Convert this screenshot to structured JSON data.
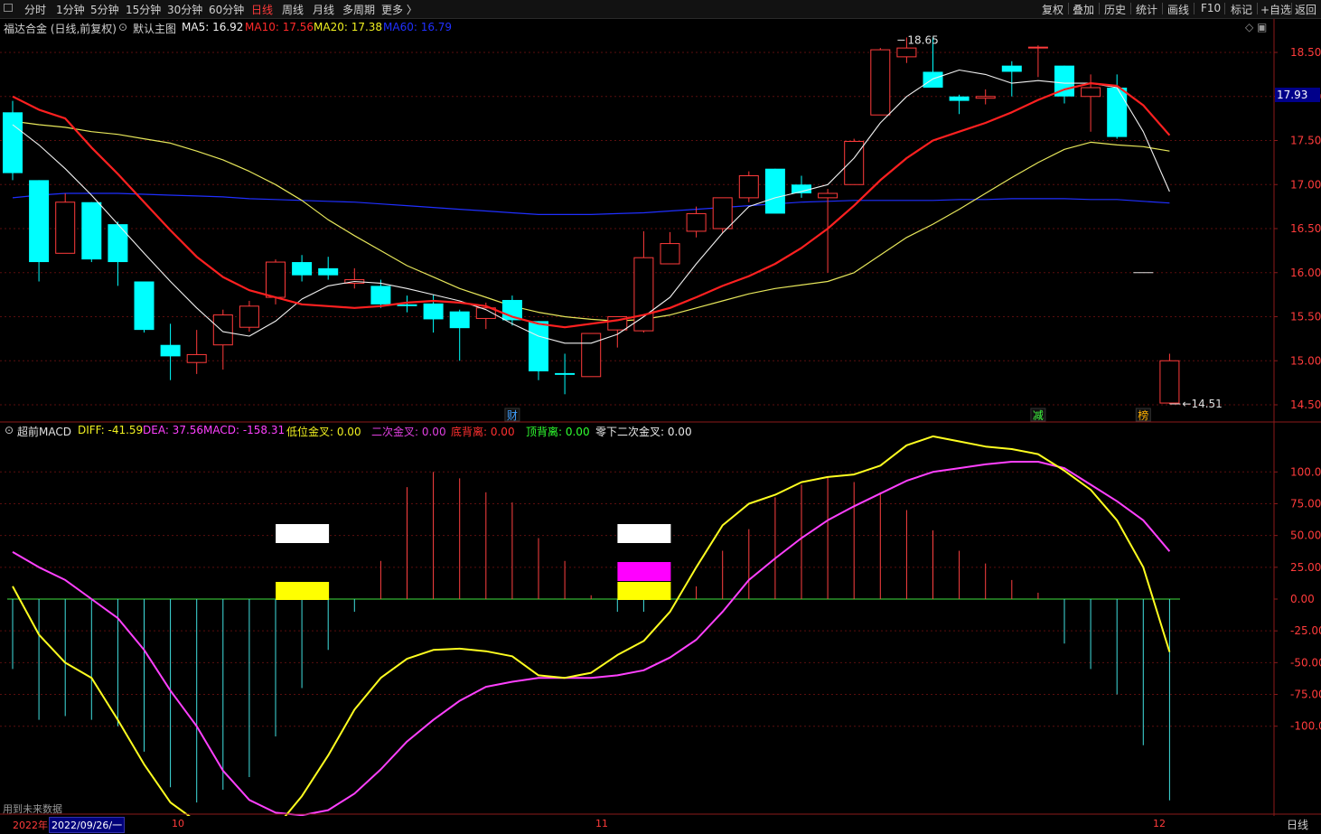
{
  "toolbar": {
    "periods": [
      "分时",
      "1分钟",
      "5分钟",
      "15分钟",
      "30分钟",
      "60分钟",
      "日线",
      "周线",
      "月线",
      "多周期",
      "更多 〉"
    ],
    "active_period": "日线",
    "right_buttons": [
      "复权",
      "叠加",
      "历史",
      "统计",
      "画线",
      "F10",
      "标记",
      "+自选",
      "返回"
    ]
  },
  "main_chart": {
    "stock_label": "福达合金 (日线,前复权)",
    "template_label": "默认主图",
    "ma": [
      {
        "name": "MA5",
        "value": "16.92",
        "color": "#f0f0f0"
      },
      {
        "name": "MA10",
        "value": "17.56",
        "color": "#ff2a2a"
      },
      {
        "name": "MA20",
        "value": "17.38",
        "color": "#f0f020"
      },
      {
        "name": "MA60",
        "value": "16.79",
        "color": "#2030ff"
      }
    ],
    "price_ticks": [
      "18.50",
      "18.00",
      "17.50",
      "17.00",
      "16.50",
      "16.00",
      "15.50",
      "15.00",
      "14.50"
    ],
    "high_label": "18.65",
    "low_label": "14.51",
    "current_price": "17.93",
    "markers": [
      {
        "text": "财",
        "color": "#40a0ff"
      },
      {
        "text": "减",
        "color": "#40ff40"
      },
      {
        "text": "榜",
        "color": "#ffb000"
      }
    ]
  },
  "macd_panel": {
    "title": "超前MACD",
    "items": [
      {
        "label": "DIFF: -41.59",
        "color": "#f0f020"
      },
      {
        "label": "DEA: 37.56",
        "color": "#ff40ff"
      },
      {
        "label": "MACD: -158.31",
        "color": "#ff40ff"
      },
      {
        "label": "低位金叉: 0.00",
        "color": "#f0f020"
      },
      {
        "label": "二次金叉: 0.00",
        "color": "#e040e0"
      },
      {
        "label": "底背离: 0.00",
        "color": "#ff3030"
      },
      {
        "label": "顶背离: 0.00",
        "color": "#30ff30"
      },
      {
        "label": "零下二次金叉: 0.00",
        "color": "#e8e8e8"
      }
    ],
    "ticks": [
      "100.0",
      "75.00",
      "50.00",
      "25.00",
      "0.00",
      "-25.00",
      "-50.00",
      "-75.00",
      "-100.0"
    ]
  },
  "footer": {
    "note": "用到未来数据",
    "year": "2022年",
    "cursor_date": "2022/09/26/一",
    "months": [
      "10",
      "11",
      "12"
    ],
    "period": "日线"
  },
  "chart_data": {
    "type": "candlestick",
    "title": "福达合金 (日线,前复权)",
    "ylim": [
      14.35,
      18.9
    ],
    "candles": [
      {
        "o": 17.82,
        "h": 17.95,
        "l": 17.05,
        "c": 17.13
      },
      {
        "o": 17.05,
        "h": 17.05,
        "l": 15.9,
        "c": 16.12
      },
      {
        "o": 16.22,
        "h": 16.9,
        "l": 16.22,
        "c": 16.8
      },
      {
        "o": 16.8,
        "h": 16.8,
        "l": 16.12,
        "c": 16.15
      },
      {
        "o": 16.55,
        "h": 16.58,
        "l": 15.85,
        "c": 16.12
      },
      {
        "o": 15.9,
        "h": 15.9,
        "l": 15.32,
        "c": 15.35
      },
      {
        "o": 15.18,
        "h": 15.42,
        "l": 14.78,
        "c": 15.05
      },
      {
        "o": 14.98,
        "h": 15.35,
        "l": 14.85,
        "c": 15.07
      },
      {
        "o": 15.18,
        "h": 15.58,
        "l": 14.9,
        "c": 15.52
      },
      {
        "o": 15.38,
        "h": 15.68,
        "l": 15.33,
        "c": 15.62
      },
      {
        "o": 15.72,
        "h": 16.15,
        "l": 15.64,
        "c": 16.12
      },
      {
        "o": 16.12,
        "h": 16.2,
        "l": 15.9,
        "c": 15.97
      },
      {
        "o": 16.05,
        "h": 16.18,
        "l": 15.92,
        "c": 15.97
      },
      {
        "o": 15.88,
        "h": 16.05,
        "l": 15.82,
        "c": 15.92
      },
      {
        "o": 15.85,
        "h": 15.92,
        "l": 15.6,
        "c": 15.64
      },
      {
        "o": 15.64,
        "h": 15.74,
        "l": 15.55,
        "c": 15.62
      },
      {
        "o": 15.65,
        "h": 15.75,
        "l": 15.32,
        "c": 15.47
      },
      {
        "o": 15.56,
        "h": 15.58,
        "l": 15.0,
        "c": 15.37
      },
      {
        "o": 15.48,
        "h": 15.66,
        "l": 15.36,
        "c": 15.6
      },
      {
        "o": 15.69,
        "h": 15.74,
        "l": 15.4,
        "c": 15.46
      },
      {
        "o": 15.45,
        "h": 15.45,
        "l": 14.78,
        "c": 14.88
      },
      {
        "o": 14.86,
        "h": 15.08,
        "l": 14.62,
        "c": 14.84
      },
      {
        "o": 14.82,
        "h": 15.3,
        "l": 14.82,
        "c": 15.31
      },
      {
        "o": 15.35,
        "h": 15.48,
        "l": 15.15,
        "c": 15.5
      },
      {
        "o": 15.34,
        "h": 16.47,
        "l": 15.32,
        "c": 16.17
      },
      {
        "o": 16.1,
        "h": 16.46,
        "l": 16.1,
        "c": 16.33
      },
      {
        "o": 16.47,
        "h": 16.75,
        "l": 16.4,
        "c": 16.67
      },
      {
        "o": 16.5,
        "h": 16.85,
        "l": 16.45,
        "c": 16.85
      },
      {
        "o": 16.85,
        "h": 17.15,
        "l": 16.8,
        "c": 17.1
      },
      {
        "o": 17.18,
        "h": 17.18,
        "l": 16.7,
        "c": 16.67
      },
      {
        "o": 17.0,
        "h": 17.1,
        "l": 16.85,
        "c": 16.9
      },
      {
        "o": 16.85,
        "h": 16.95,
        "l": 16.0,
        "c": 16.9
      },
      {
        "o": 17.0,
        "h": 17.52,
        "l": 17.0,
        "c": 17.49
      },
      {
        "o": 17.79,
        "h": 18.55,
        "l": 17.8,
        "c": 18.53
      },
      {
        "o": 18.45,
        "h": 18.67,
        "l": 18.38,
        "c": 18.55
      },
      {
        "o": 18.28,
        "h": 18.67,
        "l": 18.1,
        "c": 18.1
      },
      {
        "o": 18.0,
        "h": 18.02,
        "l": 17.8,
        "c": 17.95
      },
      {
        "o": 17.98,
        "h": 18.08,
        "l": 17.91,
        "c": 18.0
      },
      {
        "o": 18.35,
        "h": 18.4,
        "l": 18.0,
        "c": 18.28
      },
      {
        "o": 18.56,
        "h": 18.58,
        "l": 18.22,
        "c": 18.56
      },
      {
        "o": 18.35,
        "h": 18.35,
        "l": 17.92,
        "c": 18.0
      },
      {
        "o": 18.0,
        "h": 18.25,
        "l": 17.6,
        "c": 18.1
      },
      {
        "o": 18.1,
        "h": 18.25,
        "l": 17.52,
        "c": 17.54
      },
      {
        "o": 16.0,
        "h": 16.0,
        "l": 16.0,
        "c": 16.0
      },
      {
        "o": 14.52,
        "h": 15.08,
        "l": 14.51,
        "c": 15.0
      }
    ],
    "ma5": [
      17.68,
      17.45,
      17.18,
      16.88,
      16.55,
      16.22,
      15.9,
      15.6,
      15.33,
      15.28,
      15.45,
      15.7,
      15.85,
      15.9,
      15.88,
      15.82,
      15.75,
      15.68,
      15.58,
      15.42,
      15.28,
      15.2,
      15.2,
      15.3,
      15.5,
      15.72,
      16.1,
      16.45,
      16.75,
      16.85,
      16.92,
      17.0,
      17.3,
      17.7,
      18.0,
      18.2,
      18.3,
      18.25,
      18.15,
      18.18,
      18.15,
      18.15,
      18.1,
      17.6,
      16.92
    ],
    "ma10": [
      18.0,
      17.85,
      17.75,
      17.42,
      17.12,
      16.8,
      16.48,
      16.18,
      15.95,
      15.8,
      15.72,
      15.64,
      15.62,
      15.6,
      15.62,
      15.66,
      15.68,
      15.66,
      15.62,
      15.5,
      15.42,
      15.38,
      15.42,
      15.46,
      15.52,
      15.6,
      15.72,
      15.85,
      15.96,
      16.1,
      16.28,
      16.5,
      16.76,
      17.05,
      17.3,
      17.5,
      17.6,
      17.7,
      17.82,
      17.96,
      18.08,
      18.15,
      18.12,
      17.9,
      17.56
    ],
    "ma20": [
      17.72,
      17.68,
      17.65,
      17.6,
      17.57,
      17.52,
      17.47,
      17.38,
      17.28,
      17.15,
      17.0,
      16.82,
      16.6,
      16.42,
      16.25,
      16.08,
      15.95,
      15.82,
      15.72,
      15.62,
      15.55,
      15.5,
      15.47,
      15.45,
      15.47,
      15.52,
      15.6,
      15.68,
      15.76,
      15.82,
      15.86,
      15.9,
      16.0,
      16.2,
      16.4,
      16.55,
      16.72,
      16.9,
      17.08,
      17.25,
      17.4,
      17.48,
      17.45,
      17.43,
      17.38
    ],
    "ma60": [
      16.85,
      16.88,
      16.9,
      16.9,
      16.9,
      16.89,
      16.88,
      16.87,
      16.86,
      16.84,
      16.83,
      16.82,
      16.81,
      16.8,
      16.78,
      16.76,
      16.74,
      16.72,
      16.7,
      16.68,
      16.66,
      16.66,
      16.66,
      16.67,
      16.68,
      16.7,
      16.72,
      16.74,
      16.76,
      16.78,
      16.8,
      16.81,
      16.82,
      16.82,
      16.82,
      16.82,
      16.83,
      16.83,
      16.84,
      16.84,
      16.84,
      16.83,
      16.83,
      16.81,
      16.79
    ],
    "macd": {
      "ylim": [
        -168,
        123
      ],
      "diff": [
        10,
        -28,
        -50,
        -62,
        -95,
        -130,
        -160,
        -175,
        -185,
        -190,
        -180,
        -155,
        -123,
        -87,
        -62,
        -47,
        -40,
        -39,
        -41,
        -45,
        -60,
        -62,
        -58,
        -44,
        -33,
        -10,
        25,
        58,
        75,
        82,
        92,
        96,
        98,
        105,
        121,
        128,
        124,
        120,
        118,
        114,
        101,
        86,
        62,
        25,
        -41.59
      ],
      "dea": [
        37,
        25,
        15,
        0,
        -15,
        -40,
        -72,
        -100,
        -135,
        -158,
        -168,
        -170,
        -166,
        -153,
        -134,
        -112,
        -95,
        -80,
        -69,
        -65,
        -62,
        -62,
        -62,
        -60,
        -56,
        -46,
        -32,
        -10,
        15,
        32,
        48,
        62,
        73,
        83,
        93,
        100,
        103,
        106,
        108,
        108,
        103,
        90,
        77,
        62,
        37.56
      ],
      "hist": [
        -55,
        -95,
        -92,
        -95,
        -100,
        -120,
        -148,
        -160,
        -150,
        -140,
        -108,
        -70,
        -40,
        -10,
        30,
        88,
        100,
        95,
        84,
        76,
        48,
        30,
        3,
        -10,
        -10,
        3,
        10,
        38,
        55,
        80,
        90,
        96,
        92,
        84,
        70,
        54,
        38,
        28,
        15,
        5,
        -35,
        -55,
        -75,
        -115,
        -158.31
      ],
      "signal_blocks": [
        {
          "index": 11,
          "white": true,
          "magenta": false,
          "yellow": true
        },
        {
          "index": 24,
          "white": true,
          "magenta": true,
          "yellow": true
        }
      ]
    }
  }
}
